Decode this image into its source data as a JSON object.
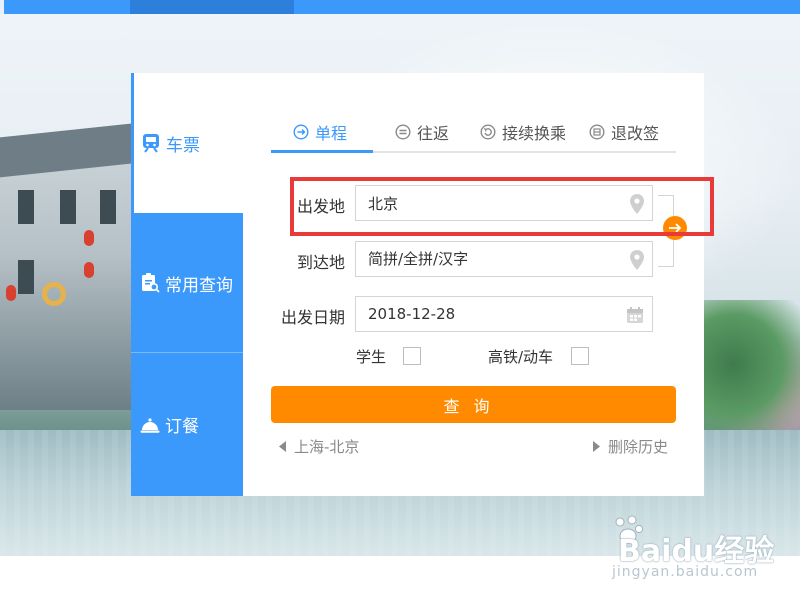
{
  "sidenav": {
    "ticket_label": "车票",
    "query_label": "常用查询",
    "meal_label": "订餐"
  },
  "tabs": [
    {
      "label": "单程",
      "icon": "arrow-circle-icon",
      "active": true
    },
    {
      "label": "往返",
      "icon": "return-circle-icon",
      "active": false
    },
    {
      "label": "接续换乘",
      "icon": "transfer-circle-icon",
      "active": false
    },
    {
      "label": "退改签",
      "icon": "refund-circle-icon",
      "active": false
    }
  ],
  "form": {
    "from_label": "出发地",
    "from_value": "北京",
    "to_label": "到达地",
    "to_placeholder": "简拼/全拼/汉字",
    "date_label": "出发日期",
    "date_value": "2018-12-28",
    "student_label": "学生",
    "highspeed_label": "高铁/动车",
    "search_label": "查询"
  },
  "history": {
    "recent": "上海-北京",
    "clear": "删除历史"
  },
  "watermark": {
    "brand": "Baidu经验",
    "url": "jingyan.baidu.com"
  },
  "colors": {
    "primary": "#3b99fc",
    "accent": "#ff8a00",
    "highlight": "#e93a3a"
  }
}
